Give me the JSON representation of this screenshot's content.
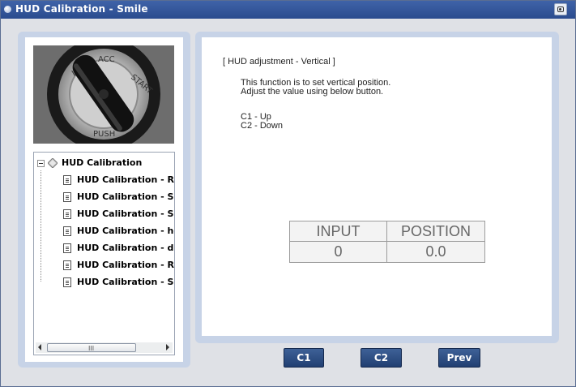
{
  "window": {
    "title": "HUD Calibration - Smile",
    "title_icon": "round-app-icon",
    "capture_icon": "camera-icon",
    "accent_color": "#2d4f92"
  },
  "sidebar": {
    "photo_alt": "ignition key image",
    "tree": {
      "root_label": "HUD Calibration",
      "root_icon": "diamond-folder-icon",
      "items": [
        {
          "label": "HUD Calibration - Ro"
        },
        {
          "label": "HUD Calibration - Sm"
        },
        {
          "label": "HUD Calibration - Slo"
        },
        {
          "label": "HUD Calibration - hor"
        },
        {
          "label": "HUD Calibration - dis"
        },
        {
          "label": "HUD Calibration - Re"
        },
        {
          "label": "HUD Calibration - Slo"
        }
      ],
      "scroll_grip": "III"
    }
  },
  "main": {
    "heading": "[ HUD adjustment - Vertical ]",
    "description_line1": "This function is to set vertical position.",
    "description_line2": "Adjust the value using below button.",
    "c1_text": "C1 - Up",
    "c2_text": "C2 - Down",
    "table": {
      "headers": [
        "INPUT",
        "POSITION"
      ],
      "values": [
        "0",
        "0.0"
      ]
    }
  },
  "buttons": {
    "c1": "C1",
    "c2": "C2",
    "prev": "Prev"
  }
}
